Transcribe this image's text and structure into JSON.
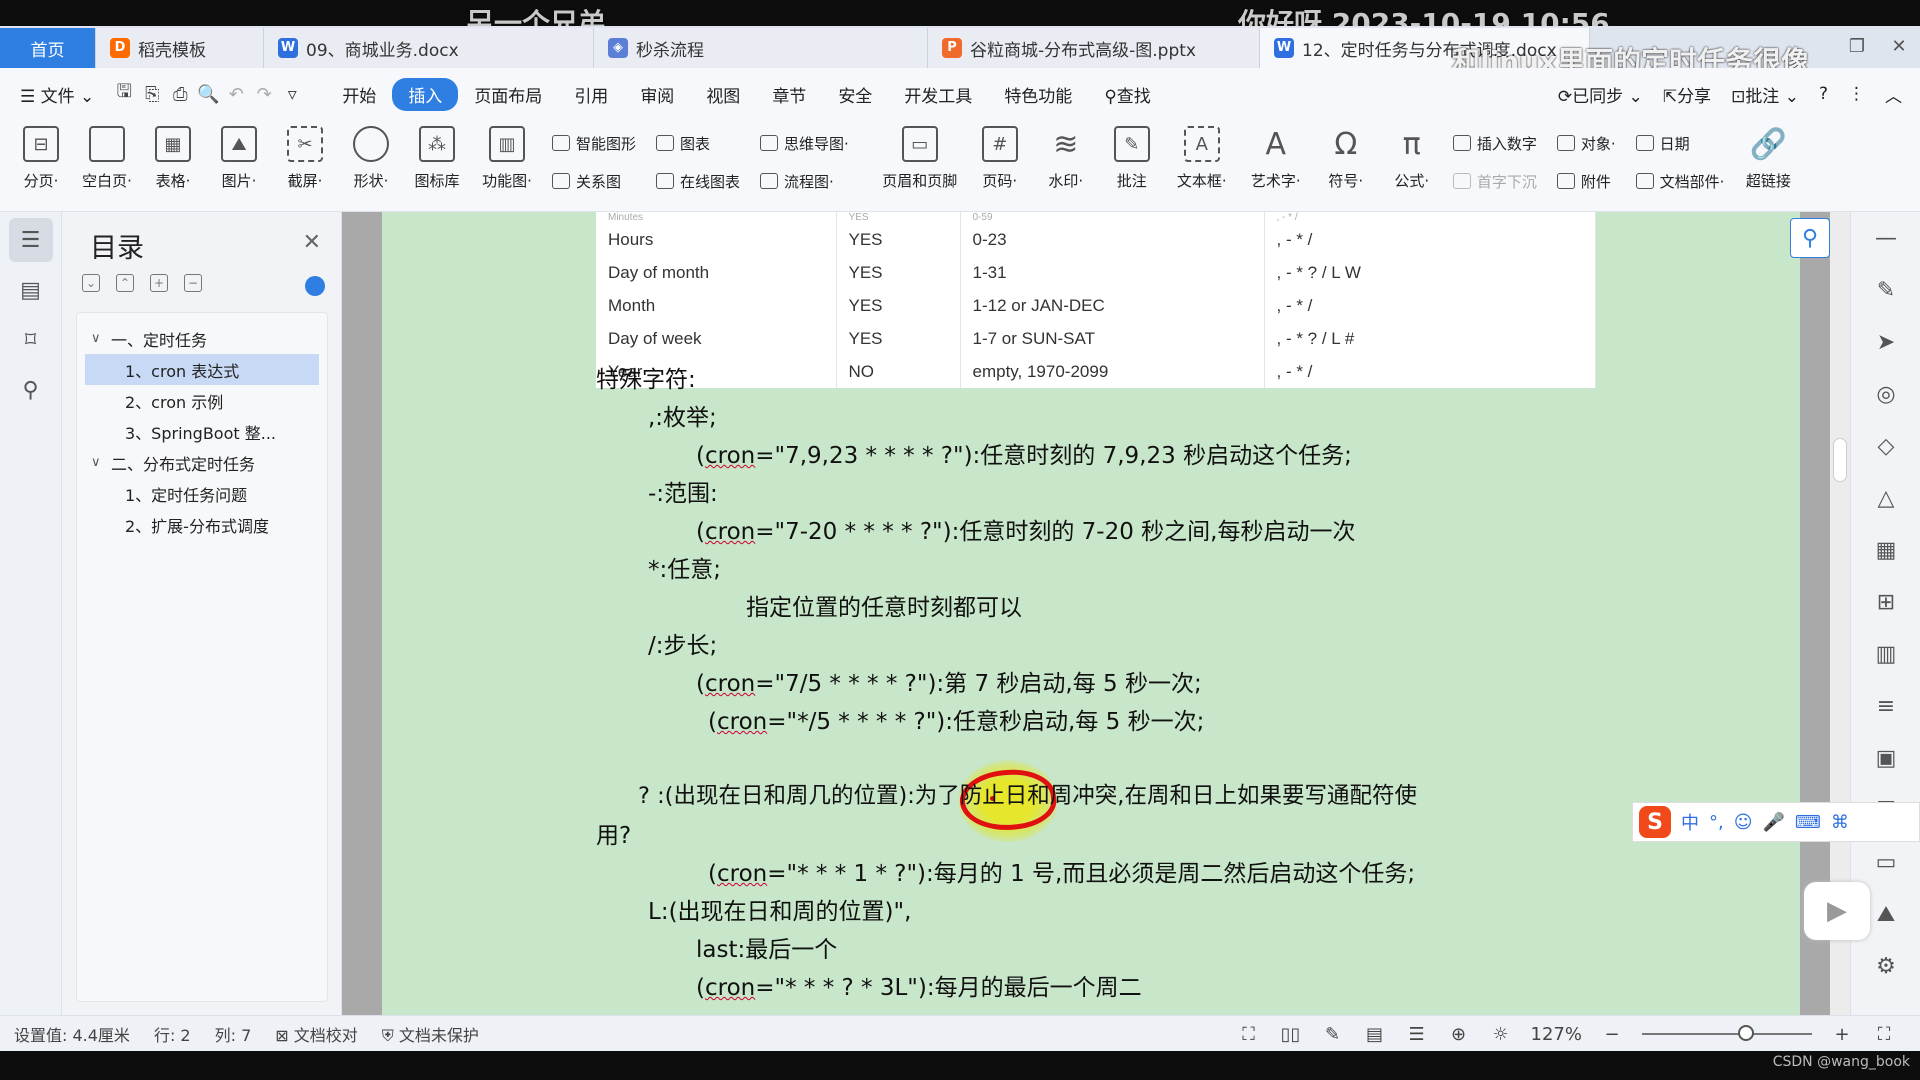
{
  "overlay": {
    "left": "另一个兄弟",
    "right": "你好呀  2023-10-19   10:56",
    "caption": "和linux里面的定时任务很像"
  },
  "tabs": [
    {
      "label": "首页",
      "icon": "none"
    },
    {
      "label": "稻壳模板",
      "icon": "docer-icon"
    },
    {
      "label": "09、商城业务.docx",
      "icon": "word-icon"
    },
    {
      "label": "秒杀流程",
      "icon": "mindmap-icon"
    },
    {
      "label": "谷粒商城-分布式高级-图.pptx",
      "icon": "ppt-icon"
    },
    {
      "label": "12、定时任务与分布式调度.docx",
      "icon": "word-icon"
    }
  ],
  "menu": {
    "file": "文件",
    "items": [
      "开始",
      "插入",
      "页面布局",
      "引用",
      "审阅",
      "视图",
      "章节",
      "安全",
      "开发工具",
      "特色功能"
    ],
    "active": "插入",
    "search": "查找",
    "synced": "已同步",
    "share": "分享",
    "comment": "批注"
  },
  "ribbon": {
    "big1": [
      {
        "label": "分页·",
        "icon": "page-break-icon"
      },
      {
        "label": "空白页·",
        "icon": "blank-page-icon"
      },
      {
        "label": "表格·",
        "icon": "table-icon"
      },
      {
        "label": "图片·",
        "icon": "picture-icon"
      },
      {
        "label": "截屏·",
        "icon": "screenshot-icon"
      },
      {
        "label": "形状·",
        "icon": "shape-icon"
      },
      {
        "label": "图标库",
        "icon": "icon-library-icon"
      },
      {
        "label": "功能图·",
        "icon": "function-chart-icon"
      }
    ],
    "col1": [
      "智能图形",
      "关系图"
    ],
    "col2": [
      "图表",
      "在线图表"
    ],
    "col3": [
      "思维导图·",
      "流程图·"
    ],
    "big2": [
      {
        "label": "页眉和页脚",
        "icon": "header-footer-icon"
      },
      {
        "label": "页码·",
        "icon": "page-number-icon"
      },
      {
        "label": "水印·",
        "icon": "watermark-icon"
      },
      {
        "label": "批注",
        "icon": "comment-icon"
      },
      {
        "label": "文本框·",
        "icon": "textbox-icon"
      },
      {
        "label": "艺术字·",
        "icon": "wordart-icon"
      },
      {
        "label": "符号·",
        "icon": "symbol-icon"
      },
      {
        "label": "公式·",
        "icon": "formula-icon"
      }
    ],
    "col4": [
      "插入数字",
      "首字下沉"
    ],
    "col5": [
      "对象·",
      "附件"
    ],
    "col6": [
      "日期",
      "文档部件·"
    ],
    "hyperlink": "超链接"
  },
  "toc": {
    "title": "目录",
    "items": [
      {
        "text": "一、定时任务",
        "level": 1
      },
      {
        "text": "1、cron 表达式",
        "level": 2,
        "selected": true
      },
      {
        "text": "2、cron 示例",
        "level": 2
      },
      {
        "text": "3、SpringBoot 整...",
        "level": 2
      },
      {
        "text": "二、分布式定时任务",
        "level": 1
      },
      {
        "text": "1、定时任务问题",
        "level": 2
      },
      {
        "text": "2、扩展-分布式调度",
        "level": 2
      }
    ]
  },
  "table": {
    "rows": [
      [
        "Minutes",
        "YES",
        "0-59",
        ", - * /"
      ],
      [
        "Hours",
        "YES",
        "0-23",
        ", - * /"
      ],
      [
        "Day of month",
        "YES",
        "1-31",
        ", - * ? / L W"
      ],
      [
        "Month",
        "YES",
        "1-12 or JAN-DEC",
        ", - * /"
      ],
      [
        "Day of week",
        "YES",
        "1-7 or SUN-SAT",
        ", - * ? / L #"
      ],
      [
        "Year",
        "NO",
        "empty, 1970-2099",
        ", - * /"
      ]
    ]
  },
  "doc": {
    "l1": "特殊字符:",
    "l2": ",:枚举;",
    "l3a": "(",
    "l3u": "cron",
    "l3b": "=\"7,9,23 * * * * ?\"):任意时刻的 7,9,23 秒启动这个任务;",
    "l4": "-:范围:",
    "l5a": "(",
    "l5u": "cron",
    "l5b": "=\"7-20 * * * * ?\"):任意时刻的 7-20 秒之间,每秒启动一次",
    "l6": "*:任意;",
    "l7": "指定位置的任意时刻都可以",
    "l8": "/:步长;",
    "l9a": "(",
    "l9u": "cron",
    "l9b": "=\"7/5 * * * * ?\"):第 7 秒启动,每 5 秒一次;",
    "l10a": "(",
    "l10u": "cron",
    "l10b": "=\"*/5 * * * * ?\"):任意秒启动,每 5 秒一次;",
    "l11": "? :(出现在日和周几的位置):为了防止日和周冲突,在周和日上如果要写通配符使",
    "l12": "用?",
    "l13a": "(",
    "l13u": "cron",
    "l13b": "=\"* * * 1 * ?\"):每月的 1 号,而且必须是周二然后启动这个任务;",
    "l14": "L:(出现在日和周的位置)\",",
    "l15": "last:最后一个",
    "l16a": "(",
    "l16u": "cron",
    "l16b": "=\"* * * ? * 3L\"):每月的最后一个周二",
    "l17": "..."
  },
  "status": {
    "setting": "设置值: 4.4厘米",
    "row": "行: 2",
    "col": "列: 7",
    "proof": "文档校对",
    "protect": "文档未保护",
    "zoom": "127%"
  },
  "ime": {
    "items": [
      "中",
      "°,",
      "☺",
      "🎤",
      "⌨"
    ]
  },
  "watermark": "CSDN @wang_book"
}
